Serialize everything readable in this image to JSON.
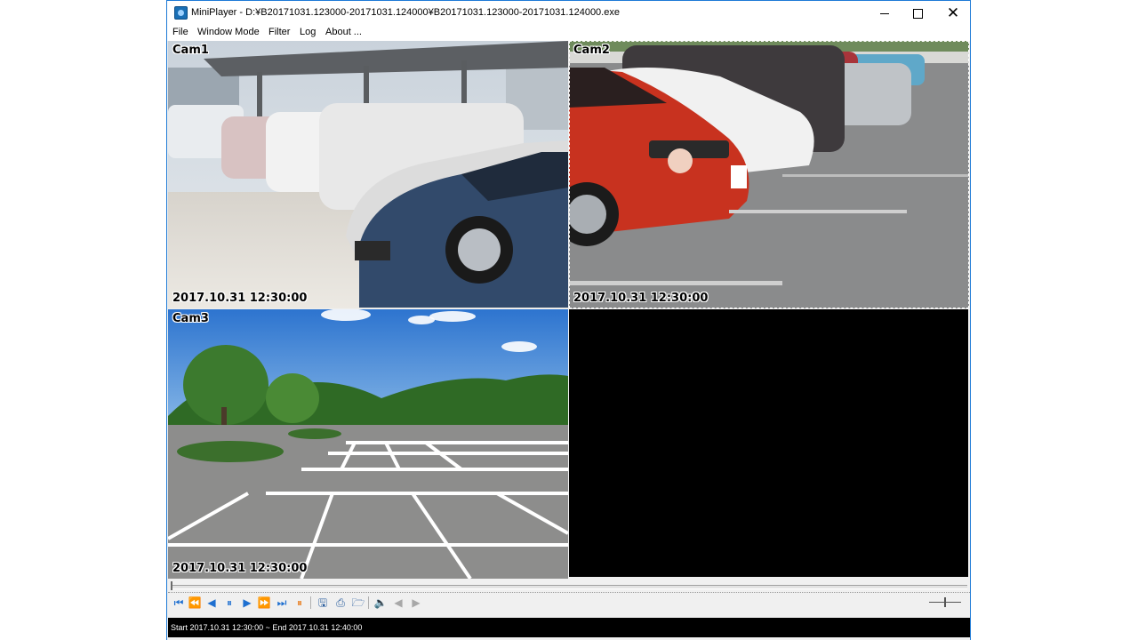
{
  "window": {
    "title": "MiniPlayer - D:¥B20171031.123000-20171031.124000¥B20171031.123000-20171031.124000.exe"
  },
  "menu": {
    "items": [
      "File",
      "Window Mode",
      "Filter",
      "Log",
      "About ..."
    ]
  },
  "cameras": [
    {
      "label": "Cam1",
      "timestamp": "2017.10.31 12:30:00"
    },
    {
      "label": "Cam2",
      "timestamp": "2017.10.31 12:30:00"
    },
    {
      "label": "Cam3",
      "timestamp": "2017.10.31 12:30:00"
    }
  ],
  "controls": {
    "icons": [
      "skip-start-icon",
      "fast-rewind-icon",
      "step-back-icon",
      "pause-icon",
      "play-icon",
      "fast-forward-icon",
      "skip-end-icon",
      "orange-pause-icon",
      "save-icon",
      "print-icon",
      "open-folder-icon",
      "audio-icon",
      "prev-disabled-icon",
      "next-disabled-icon"
    ]
  },
  "status": {
    "text": "Start  2017.10.31 12:30:00 ~ End  2017.10.31 12:40:00"
  },
  "colors": {
    "accent": "#1e6fd0",
    "highlight": "#e87d1e",
    "window_border": "#1e7ad6"
  }
}
